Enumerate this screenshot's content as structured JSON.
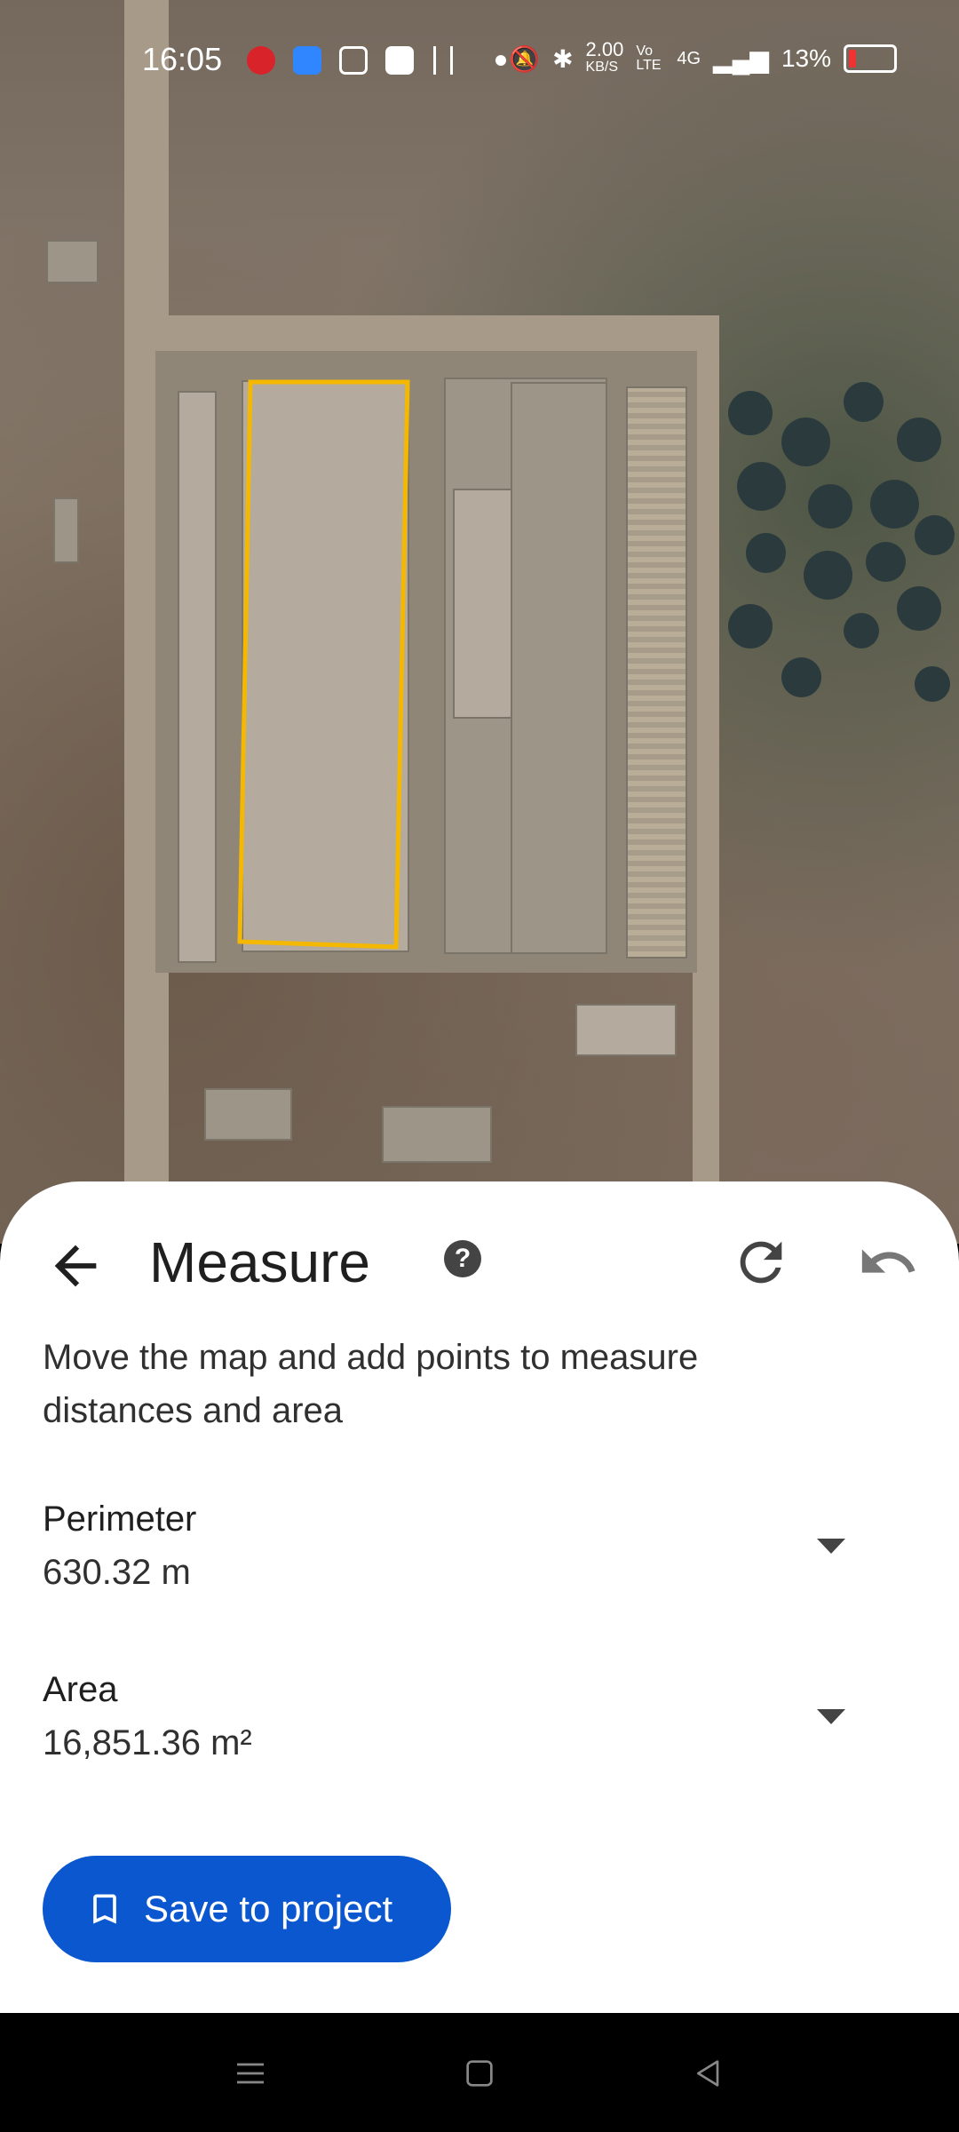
{
  "status_bar": {
    "time": "16:05",
    "network_speed": "2.00",
    "network_unit": "KB/S",
    "volte": "Vo LTE",
    "signal": "4G",
    "battery": "13%"
  },
  "measure": {
    "title": "Measure",
    "help_icon": "?",
    "instruction": "Move the map and add points to measure distances and area",
    "perimeter_label": "Perimeter",
    "perimeter_value": "630.32 m",
    "area_label": "Area",
    "area_value": "16,851.36 m²",
    "save_label": "Save to project"
  },
  "colors": {
    "selection_outline": "#f5b800",
    "accent": "#0b57d0"
  },
  "icons": {
    "back": "arrow-back-icon",
    "help": "help-icon",
    "redo": "redo-icon",
    "undo": "undo-icon",
    "bookmark": "bookmark-icon",
    "nav_menu": "menu-icon",
    "nav_home": "home-icon",
    "nav_back": "back-triangle-icon"
  }
}
